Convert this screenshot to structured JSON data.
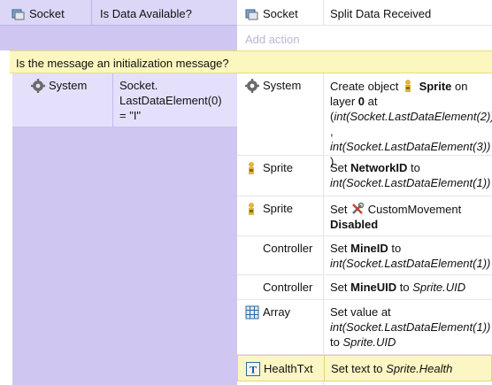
{
  "top_event": {
    "condition_object": "Socket",
    "condition_text": "Is Data Available?",
    "action_object": "Socket",
    "action_text": "Split Data Received",
    "add_action": "Add action"
  },
  "sub_event": {
    "title": "Is the message an initialization message?",
    "condition_object": "System",
    "condition_text": "Socket.\nLastDataElement(0)\n= \"I\"",
    "actions": [
      {
        "object": "System",
        "icon": "gear-icon",
        "p1": "Create object ",
        "p2": "Sprite",
        "p3": " on layer ",
        "p4": "0",
        "p5": " at (",
        "p6": "int(Socket.LastDataElement(2))",
        "p7": " , ",
        "p8": "int(Socket.LastDataElement(3))",
        "p9": " )"
      },
      {
        "object": "Sprite",
        "icon": "sprite-icon",
        "p1": "Set ",
        "p2": "NetworkID",
        "p3": " to ",
        "p4": "int(Socket.LastDataElement(1))"
      },
      {
        "object": "Sprite",
        "icon": "sprite-icon",
        "p1": "Set ",
        "p2": "CustomMovement",
        "p3": "Disabled"
      },
      {
        "object": "Controller",
        "icon": "",
        "p1": "Set ",
        "p2": "MineID",
        "p3": " to ",
        "p4": "int(Socket.LastDataElement(1))"
      },
      {
        "object": "Controller",
        "icon": "",
        "p1": "Set ",
        "p2": "MineUID",
        "p3": " to ",
        "p4": "Sprite.UID"
      },
      {
        "object": "Array",
        "icon": "array-icon",
        "p1": "Set value at ",
        "p2": "int(Socket.LastDataElement(1))",
        "p3": "  to ",
        "p4": "Sprite.UID"
      },
      {
        "object": "HealthTxt",
        "icon": "text-icon",
        "p1": "Set text to ",
        "p2": "Sprite.Health"
      }
    ]
  },
  "colors": {
    "condition_bg": "#cfc7f1",
    "title_bar": "#fbf7be",
    "highlight": "#fbf6c3"
  }
}
